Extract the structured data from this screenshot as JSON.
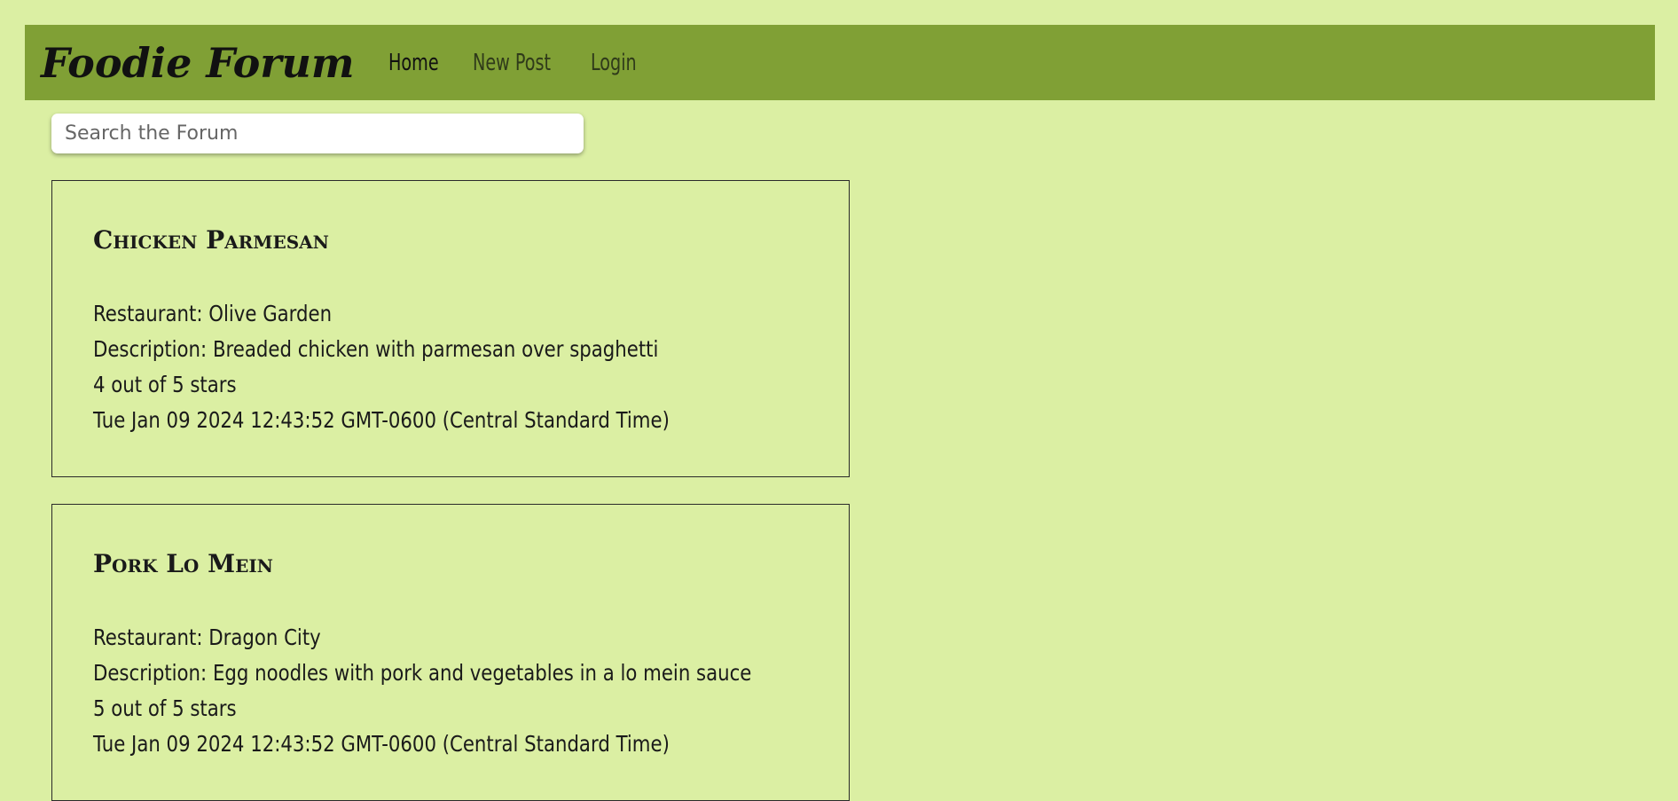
{
  "header": {
    "brand": "Foodie Forum",
    "nav": [
      {
        "label": "Home"
      },
      {
        "label": "New Post"
      },
      {
        "label": "Login"
      }
    ]
  },
  "search": {
    "placeholder": "Search the Forum"
  },
  "posts": [
    {
      "title": "Chicken Parmesan",
      "restaurant": "Restaurant: Olive Garden",
      "description": "Description: Breaded chicken with parmesan over spaghetti",
      "rating": "4 out of 5 stars",
      "date": "Tue Jan 09 2024 12:43:52 GMT-0600 (Central Standard Time)"
    },
    {
      "title": "Pork Lo Mein",
      "restaurant": "Restaurant: Dragon City",
      "description": "Description: Egg noodles with pork and vegetables in a lo mein sauce",
      "rating": "5 out of 5 stars",
      "date": "Tue Jan 09 2024 12:43:52 GMT-0600 (Central Standard Time)"
    }
  ],
  "colors": {
    "background": "#dbefa3",
    "navbar": "#80a035"
  }
}
